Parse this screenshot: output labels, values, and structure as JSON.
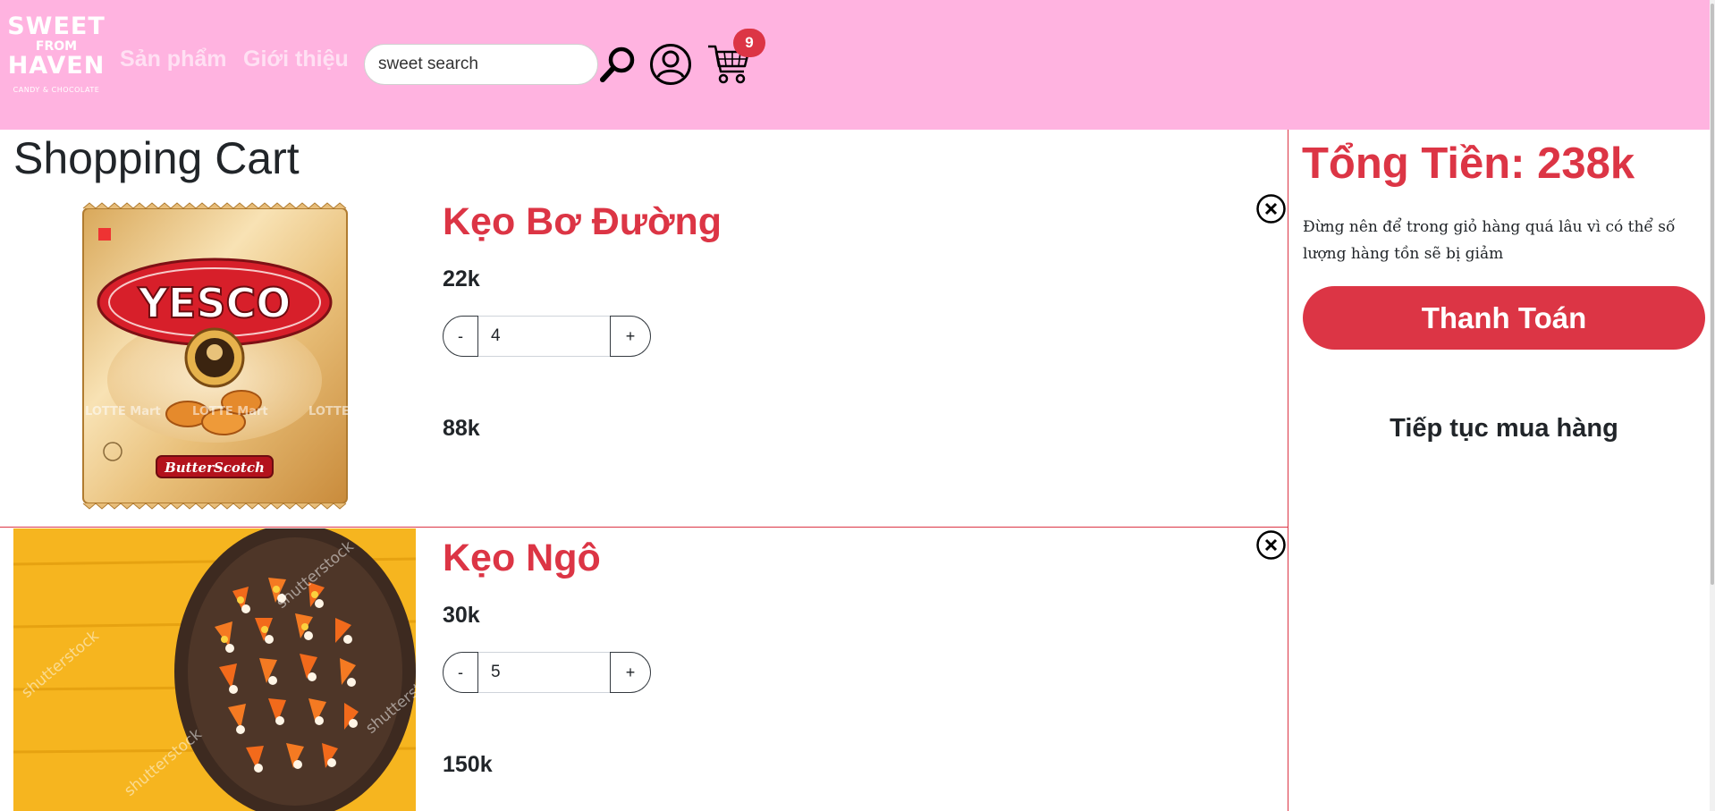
{
  "colors": {
    "header_bg": "#ffb3e0",
    "accent": "#dc3545",
    "text": "#212529"
  },
  "header": {
    "logo": {
      "line1": "SWEET",
      "line2": "FROM",
      "line3": "HAVEN",
      "tagline": "CANDY & CHOCOLATE"
    },
    "nav": [
      {
        "label": "Sản phẩm"
      },
      {
        "label": "Giới thiệu"
      }
    ],
    "search": {
      "value": "sweet search",
      "icon": "search-icon"
    },
    "account_icon": "user-icon",
    "cart": {
      "icon": "cart-icon",
      "badge_count": "9"
    }
  },
  "main": {
    "title": "Shopping Cart",
    "items": [
      {
        "name": "Kẹo Bơ Đường",
        "unit_price": "22k",
        "quantity": "4",
        "line_total": "88k",
        "image": {
          "brand": "YESCO",
          "flavor": "ButterScotch",
          "watermark": "LOTTE Mart"
        }
      },
      {
        "name": "Kẹo Ngô",
        "unit_price": "30k",
        "quantity": "5",
        "line_total": "150k",
        "image": {
          "watermark": "shutterstock"
        }
      }
    ],
    "minus_label": "-",
    "plus_label": "+"
  },
  "sidebar": {
    "total_label": "Tổng Tiền: 238k",
    "notice": "Đừng nên để trong giỏ hàng quá lâu vì có thể số lượng hàng tồn sẽ bị giảm",
    "checkout_label": "Thanh Toán",
    "continue_label": "Tiếp tục mua hàng"
  }
}
